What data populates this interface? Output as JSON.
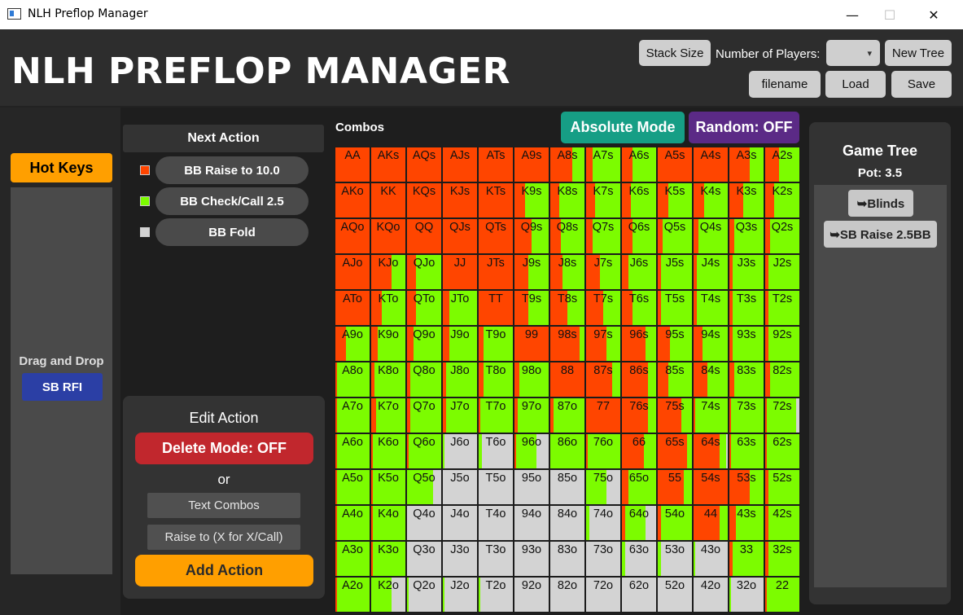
{
  "window": {
    "title": "NLH Preflop Manager",
    "minimize": "—",
    "maximize": "☐",
    "close": "✕"
  },
  "header": {
    "app_title": "NLH PREFLOP MANAGER",
    "stack_size": "Stack Size",
    "players_label": "Number of Players:",
    "players_value": "",
    "new_tree": "New Tree",
    "filename": "filename",
    "load": "Load",
    "save": "Save"
  },
  "left": {
    "hot_keys": "Hot Keys",
    "drag_drop": "Drag and Drop",
    "sb_rfi": "SB RFI"
  },
  "next_action": {
    "title": "Next Action",
    "actions": [
      {
        "label": "BB Raise to 10.0",
        "color": "#ff4500"
      },
      {
        "label": "BB Check/Call 2.5",
        "color": "#7cfc00"
      },
      {
        "label": "BB Fold",
        "color": "#d3d3d3"
      }
    ]
  },
  "edit_action": {
    "title": "Edit Action",
    "delete_mode": "Delete Mode: OFF",
    "or": "or",
    "text_combos": "Text Combos",
    "raise_to": "Raise to (X for X/Call)",
    "add_action": "Add Action"
  },
  "combos": {
    "label": "Combos",
    "absolute_mode": "Absolute Mode",
    "random": "Random: OFF",
    "rows": [
      [
        "AA",
        "AKs",
        "AQs",
        "AJs",
        "ATs",
        "A9s",
        "A8s",
        "A7s",
        "A6s",
        "A5s",
        "A4s",
        "A3s",
        "A2s"
      ],
      [
        "AKo",
        "KK",
        "KQs",
        "KJs",
        "KTs",
        "K9s",
        "K8s",
        "K7s",
        "K6s",
        "K5s",
        "K4s",
        "K3s",
        "K2s"
      ],
      [
        "AQo",
        "KQo",
        "QQ",
        "QJs",
        "QTs",
        "Q9s",
        "Q8s",
        "Q7s",
        "Q6s",
        "Q5s",
        "Q4s",
        "Q3s",
        "Q2s"
      ],
      [
        "AJo",
        "KJo",
        "QJo",
        "JJ",
        "JTs",
        "J9s",
        "J8s",
        "J7s",
        "J6s",
        "J5s",
        "J4s",
        "J3s",
        "J2s"
      ],
      [
        "ATo",
        "KTo",
        "QTo",
        "JTo",
        "TT",
        "T9s",
        "T8s",
        "T7s",
        "T6s",
        "T5s",
        "T4s",
        "T3s",
        "T2s"
      ],
      [
        "A9o",
        "K9o",
        "Q9o",
        "J9o",
        "T9o",
        "99",
        "98s",
        "97s",
        "96s",
        "95s",
        "94s",
        "93s",
        "92s"
      ],
      [
        "A8o",
        "K8o",
        "Q8o",
        "J8o",
        "T8o",
        "98o",
        "88",
        "87s",
        "86s",
        "85s",
        "84s",
        "83s",
        "82s"
      ],
      [
        "A7o",
        "K7o",
        "Q7o",
        "J7o",
        "T7o",
        "97o",
        "87o",
        "77",
        "76s",
        "75s",
        "74s",
        "73s",
        "72s"
      ],
      [
        "A6o",
        "K6o",
        "Q6o",
        "J6o",
        "T6o",
        "96o",
        "86o",
        "76o",
        "66",
        "65s",
        "64s",
        "63s",
        "62s"
      ],
      [
        "A5o",
        "K5o",
        "Q5o",
        "J5o",
        "T5o",
        "95o",
        "85o",
        "75o",
        "65o",
        "55",
        "54s",
        "53s",
        "52s"
      ],
      [
        "A4o",
        "K4o",
        "Q4o",
        "J4o",
        "T4o",
        "94o",
        "84o",
        "74o",
        "64o",
        "54o",
        "44",
        "43s",
        "42s"
      ],
      [
        "A3o",
        "K3o",
        "Q3o",
        "J3o",
        "T3o",
        "93o",
        "83o",
        "73o",
        "63o",
        "53o",
        "43o",
        "33",
        "32s"
      ],
      [
        "A2o",
        "K2o",
        "Q2o",
        "J2o",
        "T2o",
        "92o",
        "82o",
        "72o",
        "62o",
        "52o",
        "42o",
        "32o",
        "22"
      ]
    ],
    "freqs": [
      [
        [
          1,
          0,
          0
        ],
        [
          1,
          0,
          0
        ],
        [
          1,
          0,
          0
        ],
        [
          1,
          0,
          0
        ],
        [
          1,
          0,
          0
        ],
        [
          1,
          0,
          0
        ],
        [
          0.65,
          0.35,
          0
        ],
        [
          0.2,
          0.8,
          0
        ],
        [
          0.3,
          0.7,
          0
        ],
        [
          1,
          0,
          0
        ],
        [
          1,
          0,
          0
        ],
        [
          0.6,
          0.4,
          0
        ],
        [
          0.4,
          0.6,
          0
        ]
      ],
      [
        [
          1,
          0,
          0
        ],
        [
          1,
          0,
          0
        ],
        [
          1,
          0,
          0
        ],
        [
          1,
          0,
          0
        ],
        [
          1,
          0,
          0
        ],
        [
          0.3,
          0.7,
          0
        ],
        [
          0.25,
          0.75,
          0
        ],
        [
          0.25,
          0.75,
          0
        ],
        [
          0.25,
          0.75,
          0
        ],
        [
          0.3,
          0.7,
          0
        ],
        [
          0.3,
          0.7,
          0
        ],
        [
          0.4,
          0.6,
          0
        ],
        [
          0.25,
          0.75,
          0
        ]
      ],
      [
        [
          1,
          0,
          0
        ],
        [
          1,
          0,
          0
        ],
        [
          1,
          0,
          0
        ],
        [
          1,
          0,
          0
        ],
        [
          1,
          0,
          0
        ],
        [
          0.5,
          0.5,
          0
        ],
        [
          0.3,
          0.7,
          0
        ],
        [
          0.2,
          0.8,
          0
        ],
        [
          0.3,
          0.7,
          0
        ],
        [
          0.15,
          0.85,
          0
        ],
        [
          0.15,
          0.85,
          0
        ],
        [
          0.15,
          0.85,
          0
        ],
        [
          0.15,
          0.85,
          0
        ]
      ],
      [
        [
          1,
          0,
          0
        ],
        [
          0.6,
          0.4,
          0
        ],
        [
          0.25,
          0.75,
          0
        ],
        [
          1,
          0,
          0
        ],
        [
          1,
          0,
          0
        ],
        [
          0.4,
          0.6,
          0
        ],
        [
          0.35,
          0.65,
          0
        ],
        [
          0.4,
          0.6,
          0
        ],
        [
          0.2,
          0.8,
          0
        ],
        [
          0.1,
          0.9,
          0
        ],
        [
          0.1,
          0.9,
          0
        ],
        [
          0.1,
          0.9,
          0
        ],
        [
          0.1,
          0.9,
          0
        ]
      ],
      [
        [
          1,
          0,
          0
        ],
        [
          0.3,
          0.7,
          0
        ],
        [
          0.25,
          0.75,
          0
        ],
        [
          0.2,
          0.8,
          0
        ],
        [
          1,
          0,
          0
        ],
        [
          0.4,
          0.6,
          0
        ],
        [
          0.5,
          0.5,
          0
        ],
        [
          0.5,
          0.5,
          0
        ],
        [
          0.3,
          0.7,
          0
        ],
        [
          0.1,
          0.9,
          0
        ],
        [
          0.1,
          0.9,
          0
        ],
        [
          0.1,
          0.9,
          0
        ],
        [
          0.1,
          0.9,
          0
        ]
      ],
      [
        [
          0.3,
          0.7,
          0
        ],
        [
          0.2,
          0.8,
          0
        ],
        [
          0.2,
          0.8,
          0
        ],
        [
          0.2,
          0.8,
          0
        ],
        [
          0.15,
          0.85,
          0
        ],
        [
          1,
          0,
          0
        ],
        [
          0.85,
          0.15,
          0
        ],
        [
          0.6,
          0.4,
          0
        ],
        [
          0.7,
          0.3,
          0
        ],
        [
          0.35,
          0.65,
          0
        ],
        [
          0.25,
          0.75,
          0
        ],
        [
          0.1,
          0.9,
          0
        ],
        [
          0.1,
          0.9,
          0
        ]
      ],
      [
        [
          0.05,
          0.95,
          0
        ],
        [
          0.1,
          0.9,
          0
        ],
        [
          0.1,
          0.9,
          0
        ],
        [
          0.1,
          0.9,
          0
        ],
        [
          0.15,
          0.85,
          0
        ],
        [
          0.15,
          0.85,
          0
        ],
        [
          1,
          0,
          0
        ],
        [
          0.75,
          0.25,
          0
        ],
        [
          0.75,
          0.25,
          0
        ],
        [
          0.3,
          0.7,
          0
        ],
        [
          0.4,
          0.6,
          0
        ],
        [
          0.15,
          0.85,
          0
        ],
        [
          0.15,
          0.85,
          0
        ]
      ],
      [
        [
          0.05,
          0.95,
          0
        ],
        [
          0.15,
          0.85,
          0
        ],
        [
          0.1,
          0.9,
          0
        ],
        [
          0.1,
          0.9,
          0
        ],
        [
          0.05,
          0.95,
          0
        ],
        [
          0.1,
          0.9,
          0
        ],
        [
          0.1,
          0.9,
          0
        ],
        [
          1,
          0,
          0
        ],
        [
          0.75,
          0.25,
          0
        ],
        [
          0.7,
          0.3,
          0
        ],
        [
          0.05,
          0.95,
          0
        ],
        [
          0.05,
          0.95,
          0
        ],
        [
          0.05,
          0.85,
          0.1
        ]
      ],
      [
        [
          0.05,
          0.95,
          0
        ],
        [
          0.05,
          0.95,
          0
        ],
        [
          0.05,
          0.95,
          0
        ],
        [
          0,
          0.05,
          0.95
        ],
        [
          0,
          0.1,
          0.9
        ],
        [
          0.05,
          0.6,
          0.35
        ],
        [
          0,
          1,
          0
        ],
        [
          0.05,
          0.95,
          0
        ],
        [
          0.65,
          0.35,
          0
        ],
        [
          0.85,
          0.15,
          0
        ],
        [
          0.75,
          0.2,
          0.05
        ],
        [
          0.05,
          0.95,
          0
        ],
        [
          0.05,
          0.95,
          0
        ]
      ],
      [
        [
          0.05,
          0.95,
          0
        ],
        [
          0.05,
          0.95,
          0
        ],
        [
          0,
          0.75,
          0.25
        ],
        [
          0,
          0,
          1
        ],
        [
          0,
          0,
          1
        ],
        [
          0,
          0,
          1
        ],
        [
          0,
          0,
          1
        ],
        [
          0,
          0.6,
          0.4
        ],
        [
          0.2,
          0.8,
          0
        ],
        [
          0.75,
          0.25,
          0
        ],
        [
          1,
          0,
          0
        ],
        [
          0.6,
          0.4,
          0
        ],
        [
          0.1,
          0.9,
          0
        ]
      ],
      [
        [
          0.05,
          0.95,
          0
        ],
        [
          0.05,
          0.95,
          0
        ],
        [
          0,
          0,
          1
        ],
        [
          0,
          0,
          1
        ],
        [
          0,
          0,
          1
        ],
        [
          0,
          0,
          1
        ],
        [
          0,
          0,
          1
        ],
        [
          0,
          0.1,
          0.9
        ],
        [
          0.1,
          0.6,
          0.3
        ],
        [
          0.1,
          0.9,
          0
        ],
        [
          0.75,
          0.25,
          0
        ],
        [
          0.2,
          0.8,
          0
        ],
        [
          0.1,
          0.9,
          0
        ]
      ],
      [
        [
          0.05,
          0.95,
          0
        ],
        [
          0.05,
          0.95,
          0
        ],
        [
          0,
          0,
          1
        ],
        [
          0,
          0,
          1
        ],
        [
          0,
          0,
          1
        ],
        [
          0,
          0,
          1
        ],
        [
          0,
          0,
          1
        ],
        [
          0,
          0,
          1
        ],
        [
          0,
          0.1,
          0.9
        ],
        [
          0,
          0.1,
          0.9
        ],
        [
          0,
          0.05,
          0.95
        ],
        [
          0.1,
          0.9,
          0
        ],
        [
          0.1,
          0.9,
          0
        ]
      ],
      [
        [
          0.05,
          0.95,
          0
        ],
        [
          0,
          0.6,
          0.4
        ],
        [
          0,
          0.05,
          0.95
        ],
        [
          0,
          0.05,
          0.95
        ],
        [
          0,
          0.05,
          0.95
        ],
        [
          0,
          0,
          1
        ],
        [
          0,
          0,
          1
        ],
        [
          0,
          0,
          1
        ],
        [
          0,
          0,
          1
        ],
        [
          0,
          0,
          1
        ],
        [
          0,
          0,
          1
        ],
        [
          0,
          0.05,
          0.95
        ],
        [
          0.05,
          0.95,
          0
        ]
      ]
    ]
  },
  "game_tree": {
    "title": "Game Tree",
    "pot": "Pot: 3.5",
    "nodes": [
      "➥Blinds",
      "➥SB Raise 2.5BB"
    ]
  },
  "colors": {
    "raise": "#ff4500",
    "call": "#7cfc00",
    "fold": "#d3d3d3"
  }
}
